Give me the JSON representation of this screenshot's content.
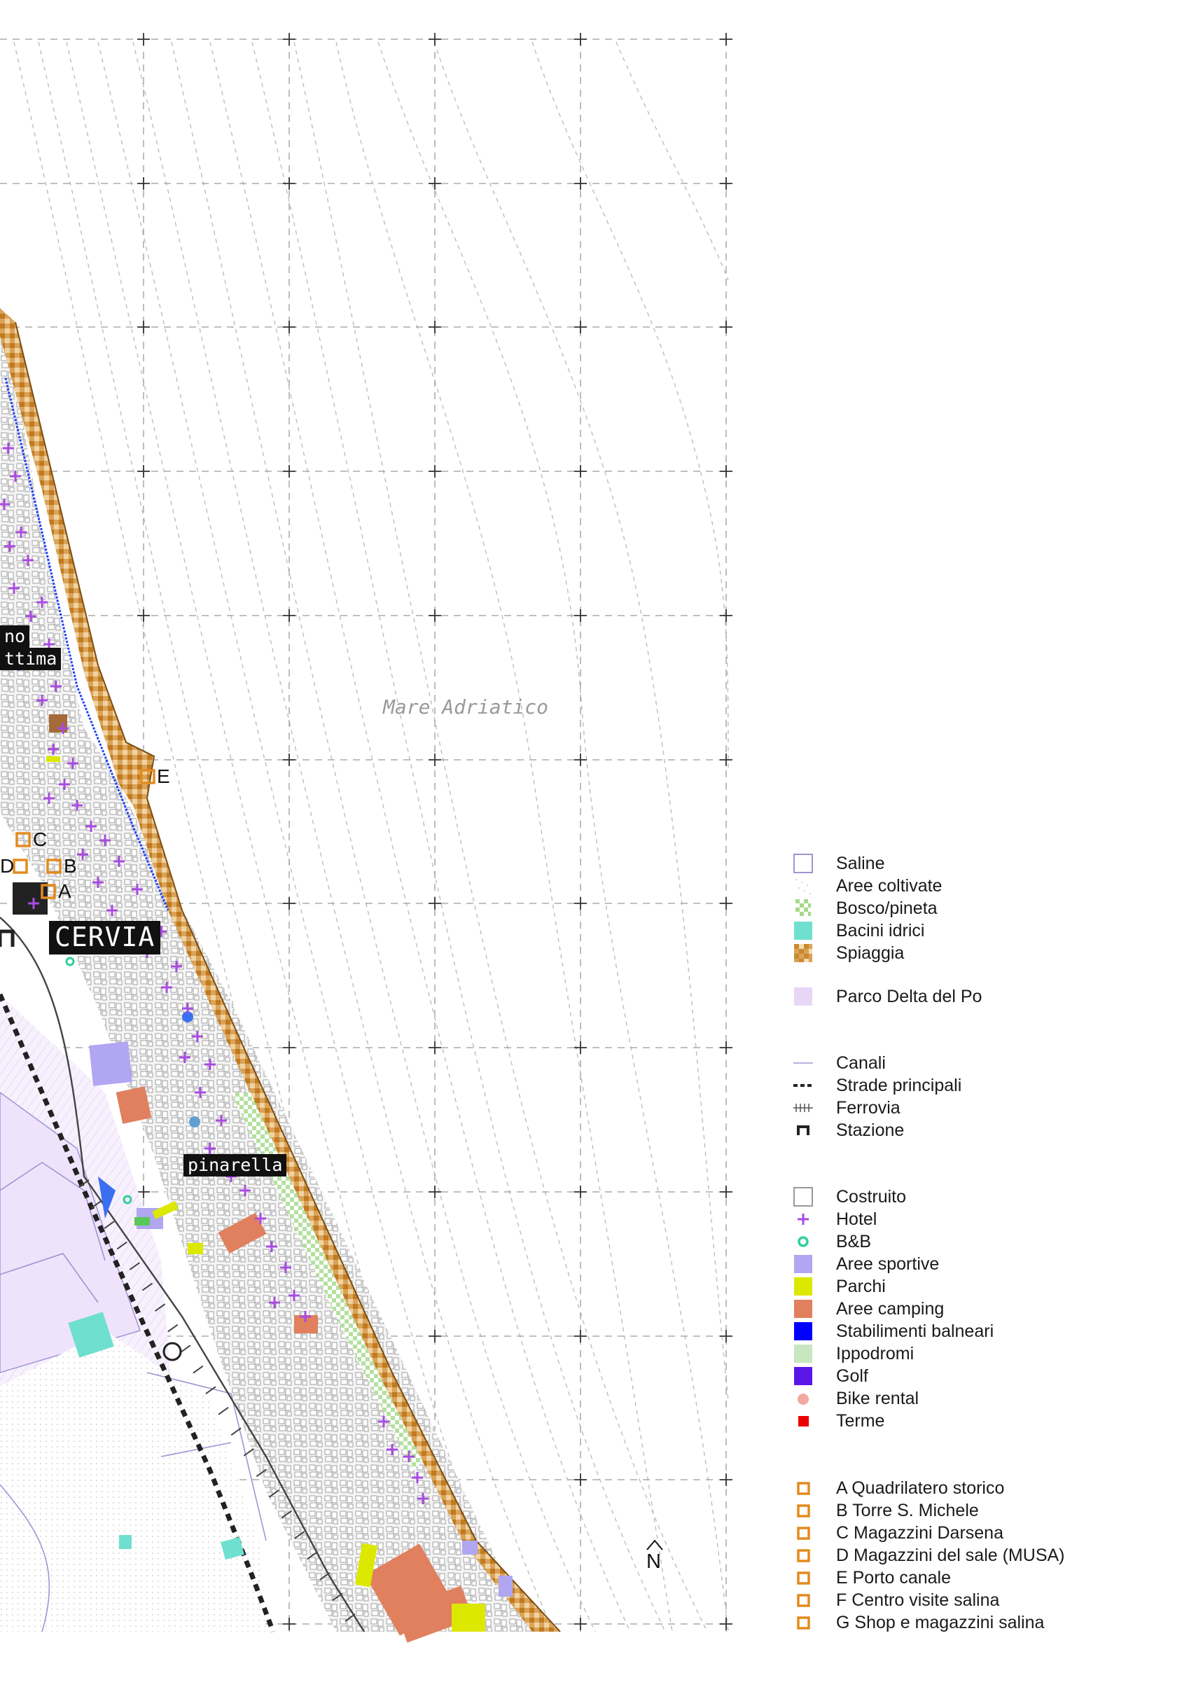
{
  "map": {
    "sea_label": "Mare Adriatico",
    "north_label": "N",
    "places": [
      {
        "id": "milano-1",
        "text": "no"
      },
      {
        "id": "milano-2",
        "text": "ttima"
      },
      {
        "id": "cervia",
        "text": "CERVIA"
      },
      {
        "id": "pinarella",
        "text": "pinarella"
      }
    ],
    "poi_markers": [
      {
        "letter": "E"
      },
      {
        "letter": "C"
      },
      {
        "letter": "D"
      },
      {
        "letter": "B"
      },
      {
        "letter": "A"
      }
    ]
  },
  "legend": {
    "land_use": [
      {
        "label": "Saline",
        "symbol": "outline-square",
        "color": "#9d95d4"
      },
      {
        "label": "Aree coltivate",
        "symbol": "dots",
        "color": "#c8c8c8"
      },
      {
        "label": "Bosco/pineta",
        "symbol": "checker",
        "color": "#a6d98a"
      },
      {
        "label": "Bacini idrici",
        "symbol": "fill",
        "color": "#6fe0cf"
      },
      {
        "label": "Spiaggia",
        "symbol": "sand",
        "color": "#c98a2e"
      }
    ],
    "protected": [
      {
        "label": "Parco Delta del Po",
        "symbol": "fill",
        "color": "#e8d6f7"
      }
    ],
    "infrastructure": [
      {
        "label": "Canali",
        "symbol": "thin-line",
        "color": "#9d95d4"
      },
      {
        "label": "Strade principali",
        "symbol": "dashed",
        "color": "#222222"
      },
      {
        "label": "Ferrovia",
        "symbol": "rail",
        "color": "#555555"
      },
      {
        "label": "Stazione",
        "symbol": "station",
        "color": "#222222"
      }
    ],
    "services": [
      {
        "label": "Costruito",
        "symbol": "outline-square",
        "color": "#999999"
      },
      {
        "label": "Hotel",
        "symbol": "cross",
        "color": "#a84be0"
      },
      {
        "label": "B&B",
        "symbol": "ring",
        "color": "#2fcf9a"
      },
      {
        "label": "Aree sportive",
        "symbol": "fill",
        "color": "#b0a6f2"
      },
      {
        "label": "Parchi",
        "symbol": "fill",
        "color": "#dde800"
      },
      {
        "label": "Aree camping",
        "symbol": "fill",
        "color": "#e0805e"
      },
      {
        "label": "Stabilimenti balneari",
        "symbol": "fill",
        "color": "#0000ff"
      },
      {
        "label": "Ippodromi",
        "symbol": "fill",
        "color": "#c8e6c0"
      },
      {
        "label": "Golf",
        "symbol": "fill",
        "color": "#5a16e8"
      },
      {
        "label": "Bike rental",
        "symbol": "dot",
        "color": "#f0a8a0"
      },
      {
        "label": "Terme",
        "symbol": "small-square",
        "color": "#ee0000"
      }
    ],
    "heritage": [
      {
        "label": "A Quadrilatero storico",
        "symbol": "orange-square",
        "color": "#e38b1e"
      },
      {
        "label": "B Torre S. Michele",
        "symbol": "orange-square",
        "color": "#e38b1e"
      },
      {
        "label": "C Magazzini Darsena",
        "symbol": "orange-square",
        "color": "#e38b1e"
      },
      {
        "label": "D Magazzini del sale (MUSA)",
        "symbol": "orange-square",
        "color": "#e38b1e"
      },
      {
        "label": "E Porto canale",
        "symbol": "orange-square",
        "color": "#e38b1e"
      },
      {
        "label": "F Centro visite salina",
        "symbol": "orange-square",
        "color": "#e38b1e"
      },
      {
        "label": "G Shop e magazzini salina",
        "symbol": "orange-square",
        "color": "#e38b1e"
      }
    ]
  }
}
